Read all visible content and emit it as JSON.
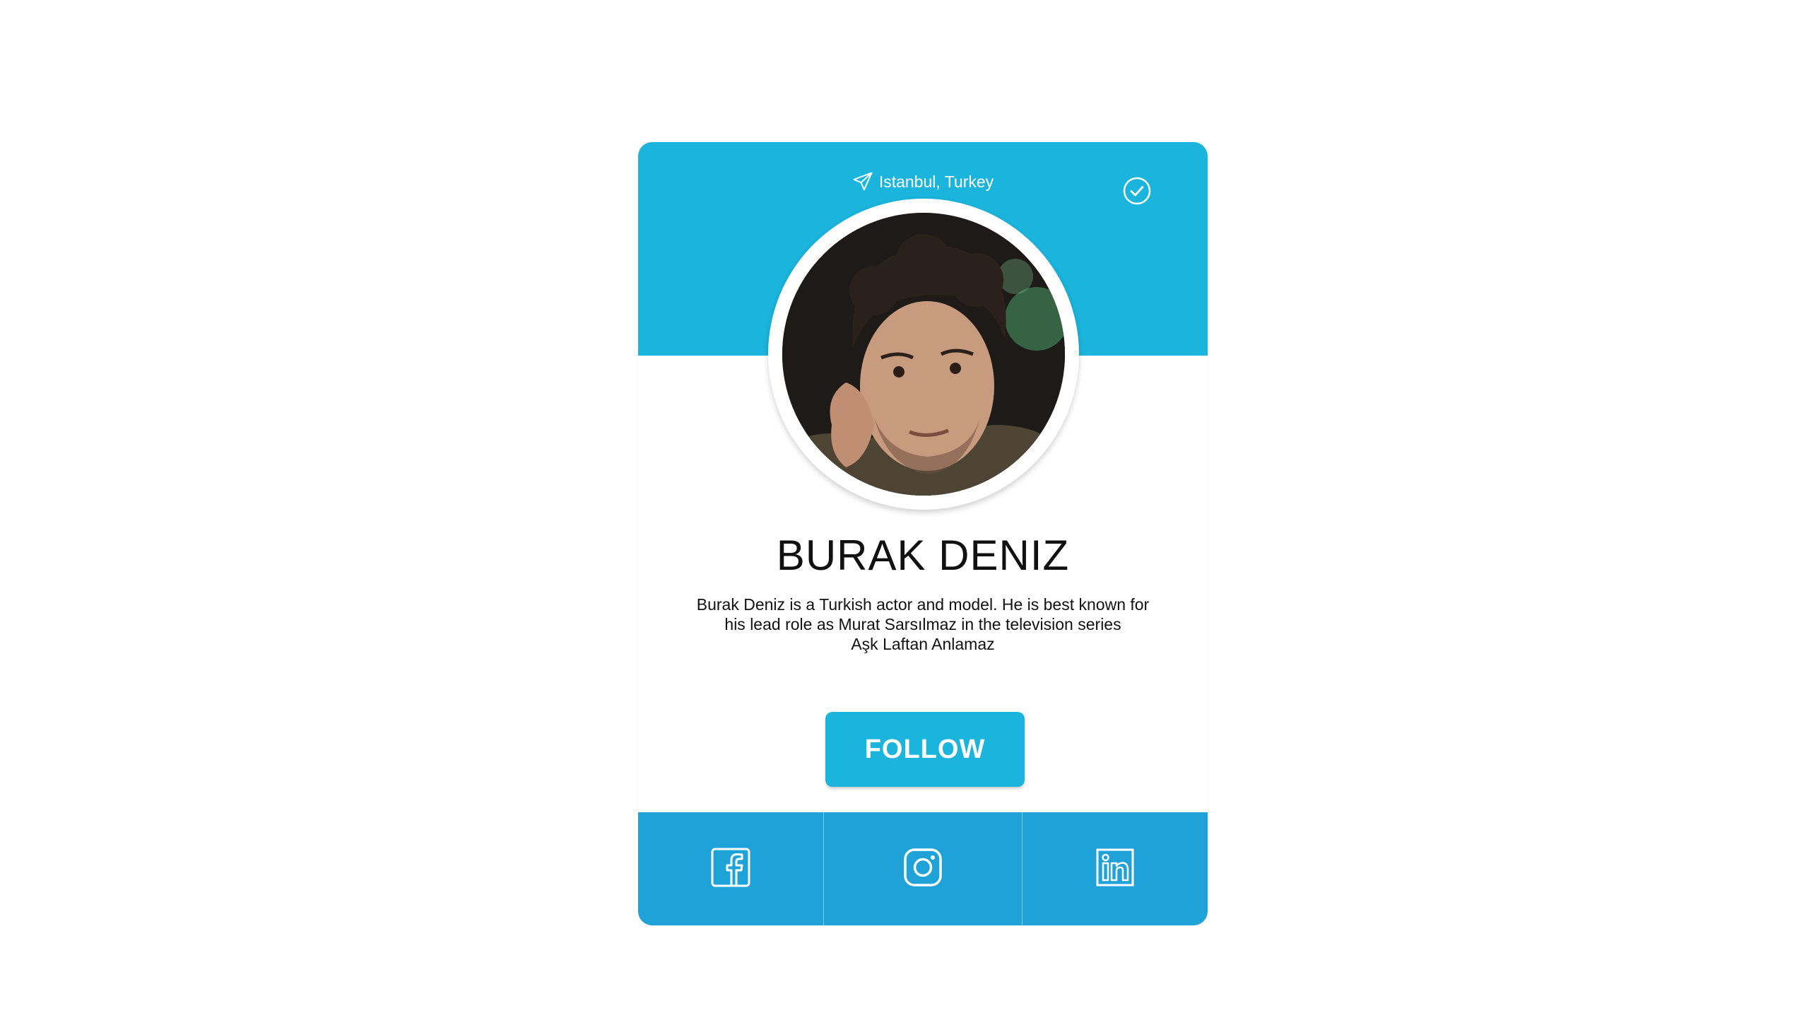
{
  "profile": {
    "location": "Istanbul, Turkey",
    "name": "BURAK DENIZ",
    "bio_lines": [
      "Burak Deniz is a Turkish actor and model. He is best known for",
      "his lead role as Murat Sarsılmaz in the television series",
      "Aşk Laftan Anlamaz"
    ],
    "follow_label": "FOLLOW"
  },
  "icons": {
    "location": "send-icon",
    "verified": "check-circle-icon",
    "social": [
      "facebook-icon",
      "instagram-icon",
      "linkedin-icon"
    ]
  },
  "colors": {
    "header": "#1bb4dc",
    "button": "#1bb4dc",
    "social_bar": "#1fa2d8"
  }
}
